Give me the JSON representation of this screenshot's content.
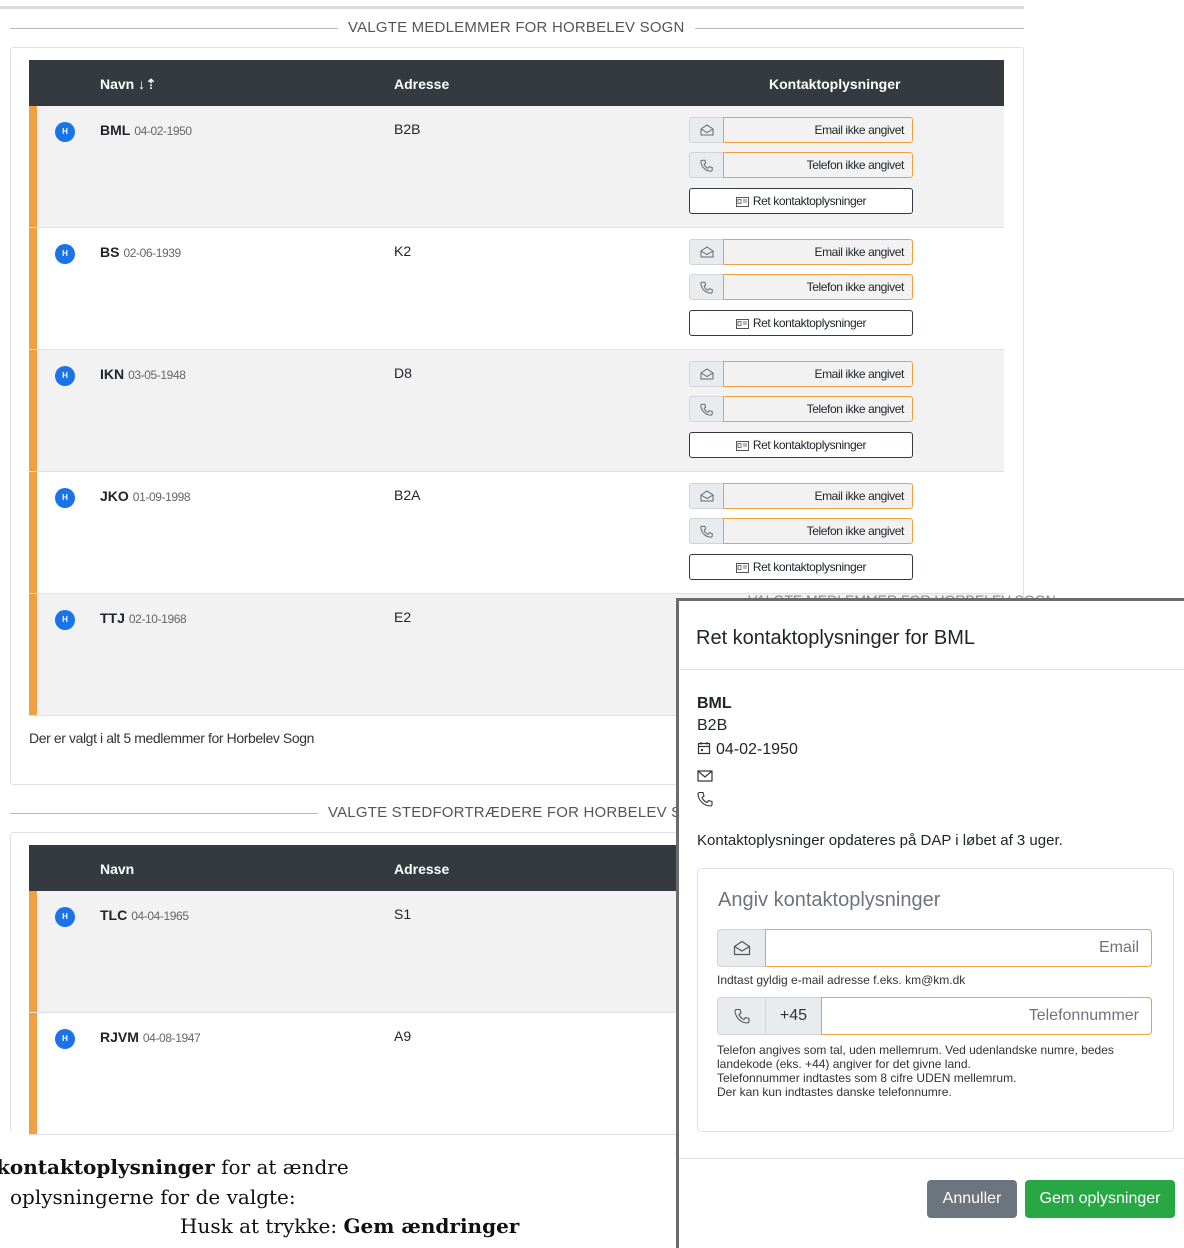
{
  "members_section": {
    "legend": "VALGTE MEDLEMMER FOR HORBELEV SOGN",
    "columns": {
      "name": "Navn ↓⇡",
      "address": "Adresse",
      "contact": "Kontaktoplysninger"
    },
    "rows": [
      {
        "badge": "H",
        "initials": "BML",
        "dob": "04-02-1950",
        "address": "B2B"
      },
      {
        "badge": "H",
        "initials": "BS",
        "dob": "02-06-1939",
        "address": "K2"
      },
      {
        "badge": "H",
        "initials": "IKN",
        "dob": "03-05-1948",
        "address": "D8"
      },
      {
        "badge": "H",
        "initials": "JKO",
        "dob": "01-09-1998",
        "address": "B2A"
      },
      {
        "badge": "H",
        "initials": "TTJ",
        "dob": "02-10-1968",
        "address": "E2"
      }
    ],
    "email_missing": "Email ikke angivet",
    "phone_missing": "Telefon ikke angivet",
    "edit_button": "Ret kontaktoplysninger",
    "footer": "Der er valgt i alt 5 medlemmer for Horbelev Sogn"
  },
  "substitutes_section": {
    "legend": "VALGTE STEDFORTRÆDERE FOR HORBELEV SO",
    "columns": {
      "name": "Navn",
      "address": "Adresse"
    },
    "rows": [
      {
        "badge": "H",
        "initials": "TLC",
        "dob": "04-04-1965",
        "address": "S1"
      },
      {
        "badge": "H",
        "initials": "RJVM",
        "dob": "04-08-1947",
        "address": "A9"
      }
    ]
  },
  "instructions": {
    "line1_bold": "kontaktoplysninger",
    "line1_rest": " for at ændre",
    "line2": "oplysningerne for de valgte:",
    "line3_prefix": "Husk at trykke: ",
    "line3_bold": "Gem ændringer"
  },
  "modal": {
    "title": "Ret kontaktoplysninger for BML",
    "ghost_text": "VALGTE MEDLEMMER FOR HORBELEV SOGN",
    "person_name": "BML",
    "person_address": "B2B",
    "person_dob": "04-02-1950",
    "notice": "Kontaktoplysninger opdateres på DAP i løbet af 3 uger.",
    "panel_title": "Angiv kontaktoplysninger",
    "email_placeholder": "Email",
    "email_value": "",
    "email_hint": "Indtast gyldig e-mail adresse f.eks. km@km.dk",
    "phone_prefix": "+45",
    "phone_placeholder": "Telefonnummer",
    "phone_value": "",
    "phone_hint_1": "Telefon angives som tal, uden mellemrum. Ved udenlandske numre, bedes",
    "phone_hint_2": "landekode (eks. +44) angiver for det givne land.",
    "phone_hint_3": "Telefonnummer indtastes som 8 cifre UDEN mellemrum.",
    "phone_hint_4": "Der kan kun indtastes danske telefonnumre.",
    "cancel_label": "Annuller",
    "save_label": "Gem oplysninger"
  },
  "colors": {
    "header": "#343a40",
    "accent_orange": "#f0a040",
    "badge_blue": "#1a73e8",
    "save_green": "#28a745",
    "cancel_gray": "#6c757d"
  },
  "icons": [
    "envelope-icon",
    "phone-icon",
    "id-card-icon",
    "calendar-icon"
  ]
}
